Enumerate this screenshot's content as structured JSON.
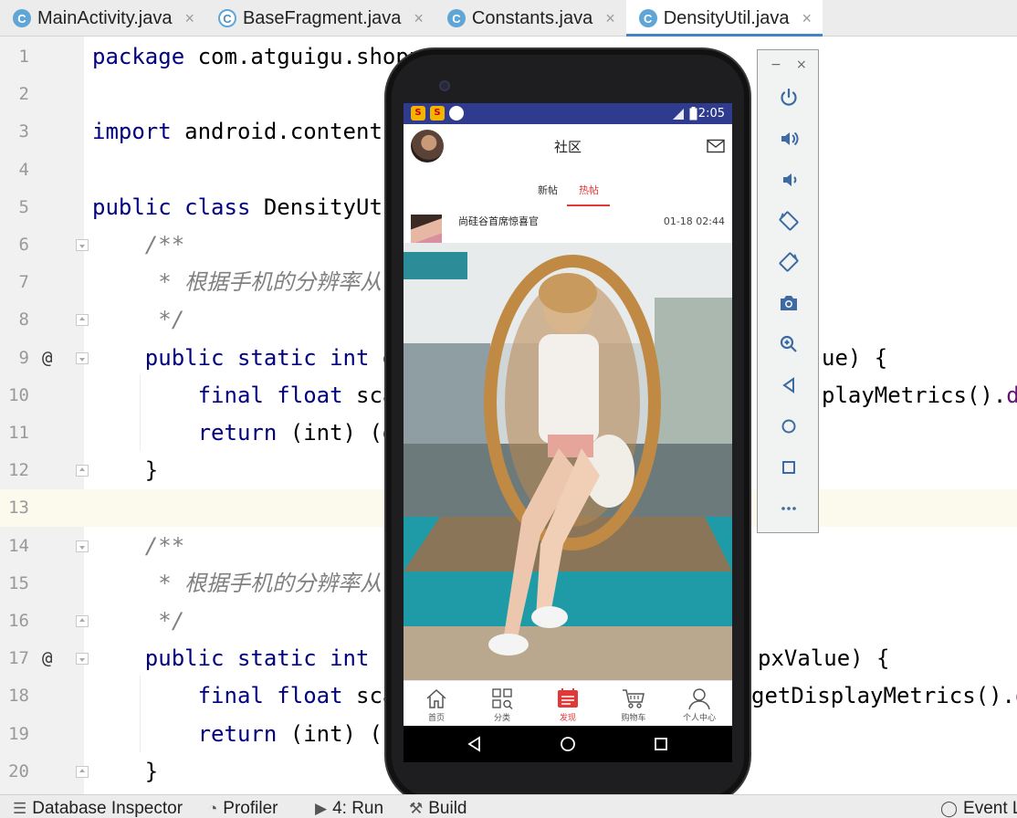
{
  "ide": {
    "tabs": [
      {
        "label": "MainActivity.java",
        "active": false
      },
      {
        "label": "BaseFragment.java",
        "active": false
      },
      {
        "label": "Constants.java",
        "active": false
      },
      {
        "label": "DensityUtil.java",
        "active": true
      }
    ],
    "tab_icon_letter": "C",
    "close_glyph": "×",
    "gutter_marker": "@",
    "current_line": 13,
    "lines": [
      {
        "n": "1",
        "t": "package com.atguigu.shopp"
      },
      {
        "n": "2",
        "t": ""
      },
      {
        "n": "3",
        "t": "import android.content."
      },
      {
        "n": "4",
        "t": ""
      },
      {
        "n": "5",
        "t": "public class DensityUti"
      },
      {
        "n": "6",
        "t": "    /**"
      },
      {
        "n": "7",
        "t": "     * 根据手机的分辨率从 d"
      },
      {
        "n": "8",
        "t": "     */"
      },
      {
        "n": "9",
        "t": "    public static int d"
      },
      {
        "n": "10",
        "t": "        final float sca"
      },
      {
        "n": "11",
        "t": "        return (int) (d"
      },
      {
        "n": "12",
        "t": "    }"
      },
      {
        "n": "13",
        "t": ""
      },
      {
        "n": "14",
        "t": "    /**"
      },
      {
        "n": "15",
        "t": "     * 根据手机的分辨率从 p"
      },
      {
        "n": "16",
        "t": "     */"
      },
      {
        "n": "17",
        "t": "    public static int p"
      },
      {
        "n": "18",
        "t": "        final float sca"
      },
      {
        "n": "19",
        "t": "        return (int) (p"
      },
      {
        "n": "20",
        "t": "    }"
      }
    ],
    "right_fragments": [
      {
        "line": 9,
        "t": "ue) {"
      },
      {
        "line": 10,
        "t": "playMetrics().de"
      },
      {
        "line": 17,
        "t": "pxValue) {"
      },
      {
        "line": 18,
        "t": "getDisplayMetrics().de"
      }
    ],
    "bottom_tools": [
      {
        "label": "Database Inspector",
        "icon": "database-icon"
      },
      {
        "label": "Profiler",
        "icon": "gauge-icon"
      },
      {
        "label": "4: Run",
        "icon": "run-icon"
      },
      {
        "label": "Build",
        "icon": "hammer-icon"
      },
      {
        "label": "Event L",
        "icon": "event-log-icon"
      }
    ]
  },
  "emulator": {
    "minimize_glyph": "−",
    "close_glyph": "×",
    "buttons": [
      "power-icon",
      "volume-up-icon",
      "volume-down-icon",
      "rotate-left-icon",
      "rotate-right-icon",
      "camera-icon",
      "zoom-icon",
      "back-icon",
      "home-icon",
      "overview-icon",
      "more-icon"
    ]
  },
  "phone": {
    "status_time": "2:05",
    "app_title": "社区",
    "tabs": [
      {
        "label": "新帖",
        "active": false
      },
      {
        "label": "热帖",
        "active": true
      }
    ],
    "post": {
      "username": "尚硅谷首席惊喜官",
      "time": "01-18 02:44"
    },
    "bottom_nav": [
      {
        "label": "首页",
        "icon": "home-icon",
        "active": false
      },
      {
        "label": "分类",
        "icon": "category-icon",
        "active": false
      },
      {
        "label": "发现",
        "icon": "discover-icon",
        "active": true
      },
      {
        "label": "购物车",
        "icon": "cart-icon",
        "active": false
      },
      {
        "label": "个人中心",
        "icon": "user-icon",
        "active": false
      }
    ],
    "colors": {
      "status_bar": "#2e3b8e",
      "accent": "#e0393a"
    }
  }
}
